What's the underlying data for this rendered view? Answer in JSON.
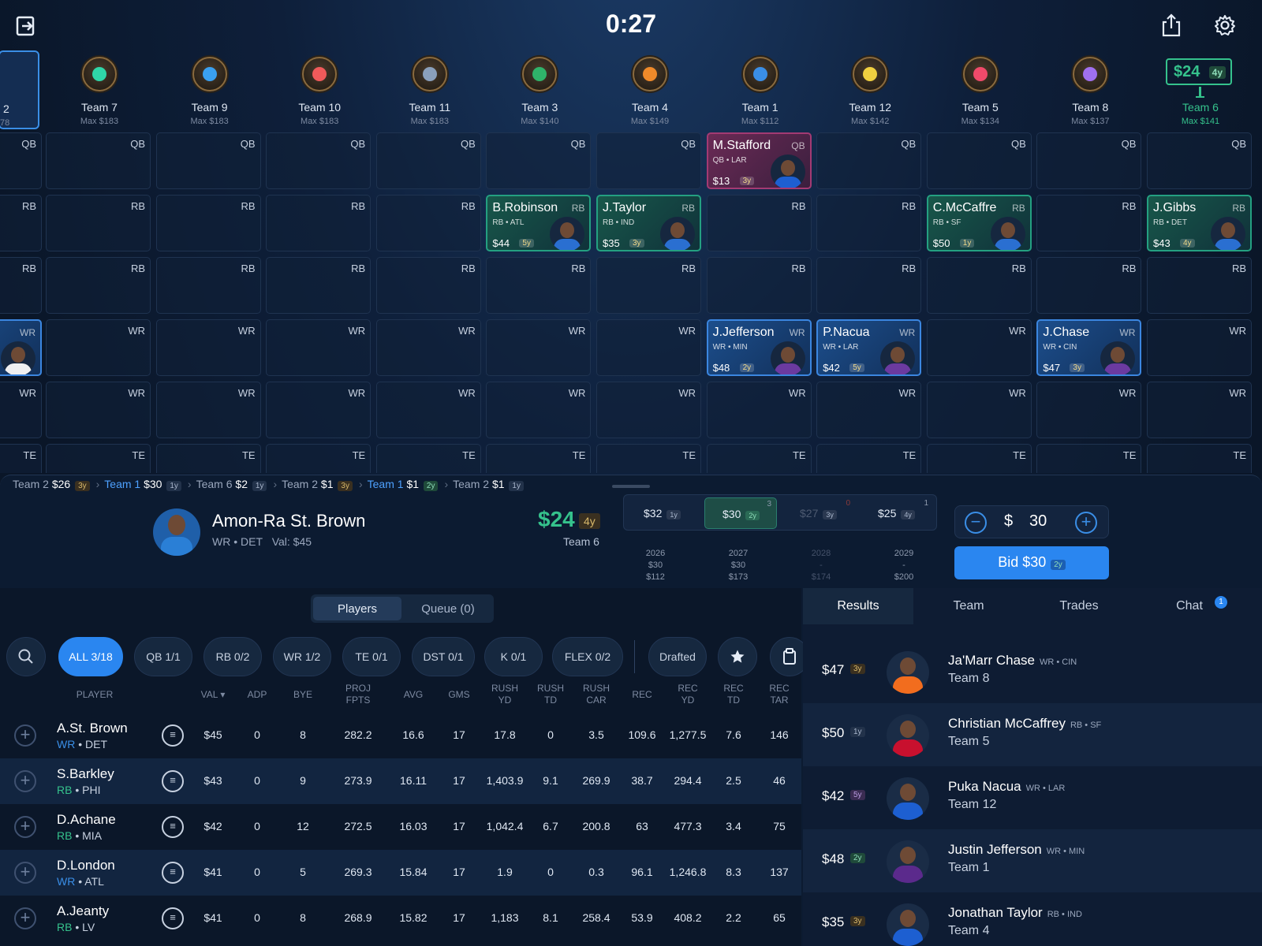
{
  "timer": "0:27",
  "header": {
    "exit_icon": "exit-icon",
    "share_icon": "share-icon",
    "settings_icon": "gear-icon"
  },
  "prev_team": {
    "name": "2",
    "max": "78"
  },
  "teams": [
    {
      "name": "Team 7",
      "max": "Max $183",
      "color": "#2fd6a8"
    },
    {
      "name": "Team 9",
      "max": "Max $183",
      "color": "#3aa0f0"
    },
    {
      "name": "Team 10",
      "max": "Max $183",
      "color": "#f05a5a"
    },
    {
      "name": "Team 11",
      "max": "Max $183",
      "color": "#8aa0bc"
    },
    {
      "name": "Team 3",
      "max": "Max $140",
      "color": "#2fb36a"
    },
    {
      "name": "Team 4",
      "max": "Max $149",
      "color": "#f08a2a"
    },
    {
      "name": "Team 1",
      "max": "Max $112",
      "color": "#3a8ee6"
    },
    {
      "name": "Team 12",
      "max": "Max $142",
      "color": "#f0d040"
    },
    {
      "name": "Team 5",
      "max": "Max $134",
      "color": "#f04a6a"
    },
    {
      "name": "Team 8",
      "max": "Max $137",
      "color": "#a070f0"
    },
    {
      "name": "Team 6",
      "max": "Max $141",
      "color": "#35c28c",
      "active": true,
      "price": "$24",
      "years": "4y"
    }
  ],
  "rows": [
    "QB",
    "RB",
    "RB",
    "WR",
    "WR",
    "TE"
  ],
  "picks": [
    {
      "col": 6,
      "row": 0,
      "name": "M.Stafford",
      "pos": "QB",
      "team": "QB • LAR",
      "price": "$13",
      "years": "3y",
      "kind": "qb"
    },
    {
      "col": 4,
      "row": 1,
      "name": "B.Robinson",
      "pos": "RB",
      "team": "RB • ATL",
      "price": "$44",
      "years": "5y",
      "kind": "rb"
    },
    {
      "col": 5,
      "row": 1,
      "name": "J.Taylor",
      "pos": "RB",
      "team": "RB • IND",
      "price": "$35",
      "years": "3y",
      "kind": "rb"
    },
    {
      "col": 8,
      "row": 1,
      "name": "C.McCaffre",
      "pos": "RB",
      "team": "RB • SF",
      "price": "$50",
      "years": "1y",
      "kind": "rb"
    },
    {
      "col": 10,
      "row": 1,
      "name": "J.Gibbs",
      "pos": "RB",
      "team": "RB • DET",
      "price": "$43",
      "years": "4y",
      "kind": "rb"
    },
    {
      "col": 6,
      "row": 3,
      "name": "J.Jefferson",
      "pos": "WR",
      "team": "WR • MIN",
      "price": "$48",
      "years": "2y",
      "kind": "wr"
    },
    {
      "col": 7,
      "row": 3,
      "name": "P.Nacua",
      "pos": "WR",
      "team": "WR • LAR",
      "price": "$42",
      "years": "5y",
      "kind": "wr"
    },
    {
      "col": 9,
      "row": 3,
      "name": "J.Chase",
      "pos": "WR",
      "team": "WR • CIN",
      "price": "$47",
      "years": "3y",
      "kind": "wr"
    }
  ],
  "partial_pick": {
    "row": 3,
    "pos": "WR"
  },
  "history": [
    {
      "team": "Team 2",
      "price": "$26",
      "years": "3y",
      "highlight": false
    },
    {
      "team": "Team 1",
      "price": "$30",
      "years": "1y",
      "highlight": true
    },
    {
      "team": "Team 6",
      "price": "$2",
      "years": "1y",
      "highlight": false
    },
    {
      "team": "Team 2",
      "price": "$1",
      "years": "3y",
      "highlight": false
    },
    {
      "team": "Team 1",
      "price": "$1",
      "years": "2y",
      "highlight": true
    },
    {
      "team": "Team 2",
      "price": "$1",
      "years": "1y",
      "highlight": false
    }
  ],
  "nominated": {
    "name": "Amon-Ra St. Brown",
    "pos_team": "WR • DET",
    "val": "Val: $45",
    "current_bid": "$24",
    "current_years": "4y",
    "current_team": "Team 6"
  },
  "year_options": [
    {
      "price": "$32",
      "years": "1y",
      "sup": "",
      "year": "2026",
      "v1": "$30",
      "v2": "$112",
      "state": "normal"
    },
    {
      "price": "$30",
      "years": "2y",
      "sup": "3",
      "year": "2027",
      "v1": "$30",
      "v2": "$173",
      "state": "selected"
    },
    {
      "price": "$27",
      "years": "3y",
      "sup": "0",
      "year": "2028",
      "v1": "-",
      "v2": "$174",
      "state": "dim"
    },
    {
      "price": "$25",
      "years": "4y",
      "sup": "1",
      "year": "2029",
      "v1": "-",
      "v2": "$200",
      "state": "normal"
    }
  ],
  "bid": {
    "currency": "$",
    "amount": "30",
    "minus": "−",
    "plus": "+",
    "button_label": "Bid $30",
    "button_years": "2y"
  },
  "tabs": {
    "players": "Players",
    "queue": "Queue (0)"
  },
  "filters": [
    {
      "label": "ALL 3/18",
      "selected": true
    },
    {
      "label": "QB 1/1"
    },
    {
      "label": "RB 0/2"
    },
    {
      "label": "WR 1/2"
    },
    {
      "label": "TE 0/1"
    },
    {
      "label": "DST 0/1"
    },
    {
      "label": "K 0/1"
    },
    {
      "label": "FLEX 0/2"
    },
    {
      "label": "Drafted"
    }
  ],
  "columns": [
    "PLAYER",
    "VAL ▾",
    "ADP",
    "BYE",
    "PROJ\nFPTS",
    "AVG",
    "GMS",
    "RUSH\nYD",
    "RUSH\nTD",
    "RUSH\nCAR",
    "REC",
    "REC\nYD",
    "REC\nTD",
    "REC\nTAR"
  ],
  "players": [
    {
      "name": "A.St. Brown",
      "pos": "WR",
      "team": "DET",
      "cells": [
        "$45",
        "0",
        "8",
        "282.2",
        "16.6",
        "17",
        "17.8",
        "0",
        "3.5",
        "109.6",
        "1,277.5",
        "7.6",
        "146"
      ]
    },
    {
      "name": "S.Barkley",
      "pos": "RB",
      "team": "PHI",
      "cells": [
        "$43",
        "0",
        "9",
        "273.9",
        "16.11",
        "17",
        "1,403.9",
        "9.1",
        "269.9",
        "38.7",
        "294.4",
        "2.5",
        "46"
      ]
    },
    {
      "name": "D.Achane",
      "pos": "RB",
      "team": "MIA",
      "cells": [
        "$42",
        "0",
        "12",
        "272.5",
        "16.03",
        "17",
        "1,042.4",
        "6.7",
        "200.8",
        "63",
        "477.3",
        "3.4",
        "75"
      ]
    },
    {
      "name": "D.London",
      "pos": "WR",
      "team": "ATL",
      "cells": [
        "$41",
        "0",
        "5",
        "269.3",
        "15.84",
        "17",
        "1.9",
        "0",
        "0.3",
        "96.1",
        "1,246.8",
        "8.3",
        "137"
      ]
    },
    {
      "name": "A.Jeanty",
      "pos": "RB",
      "team": "LV",
      "cells": [
        "$41",
        "0",
        "8",
        "268.9",
        "15.82",
        "17",
        "1,183",
        "8.1",
        "258.4",
        "53.9",
        "408.2",
        "2.2",
        "65"
      ]
    }
  ],
  "right_tabs": {
    "results": "Results",
    "team": "Team",
    "trades": "Trades",
    "chat": "Chat",
    "chat_badge": "1"
  },
  "results": [
    {
      "price": "$47",
      "years": "3y",
      "name": "Ja'Marr Chase",
      "pos": "WR • CIN",
      "team": "Team 8",
      "jersey": "#f26d1e"
    },
    {
      "price": "$50",
      "years": "1y",
      "name": "Christian McCaffrey",
      "pos": "RB • SF",
      "team": "Team 5",
      "jersey": "#c8102e"
    },
    {
      "price": "$42",
      "years": "5y",
      "name": "Puka Nacua",
      "pos": "WR • LAR",
      "team": "Team 12",
      "jersey": "#1d5fd1"
    },
    {
      "price": "$48",
      "years": "2y",
      "name": "Justin Jefferson",
      "pos": "WR • MIN",
      "team": "Team 1",
      "jersey": "#5b2a8c"
    },
    {
      "price": "$35",
      "years": "3y",
      "name": "Jonathan Taylor",
      "pos": "RB • IND",
      "team": "Team 4",
      "jersey": "#1d5fd1"
    }
  ]
}
